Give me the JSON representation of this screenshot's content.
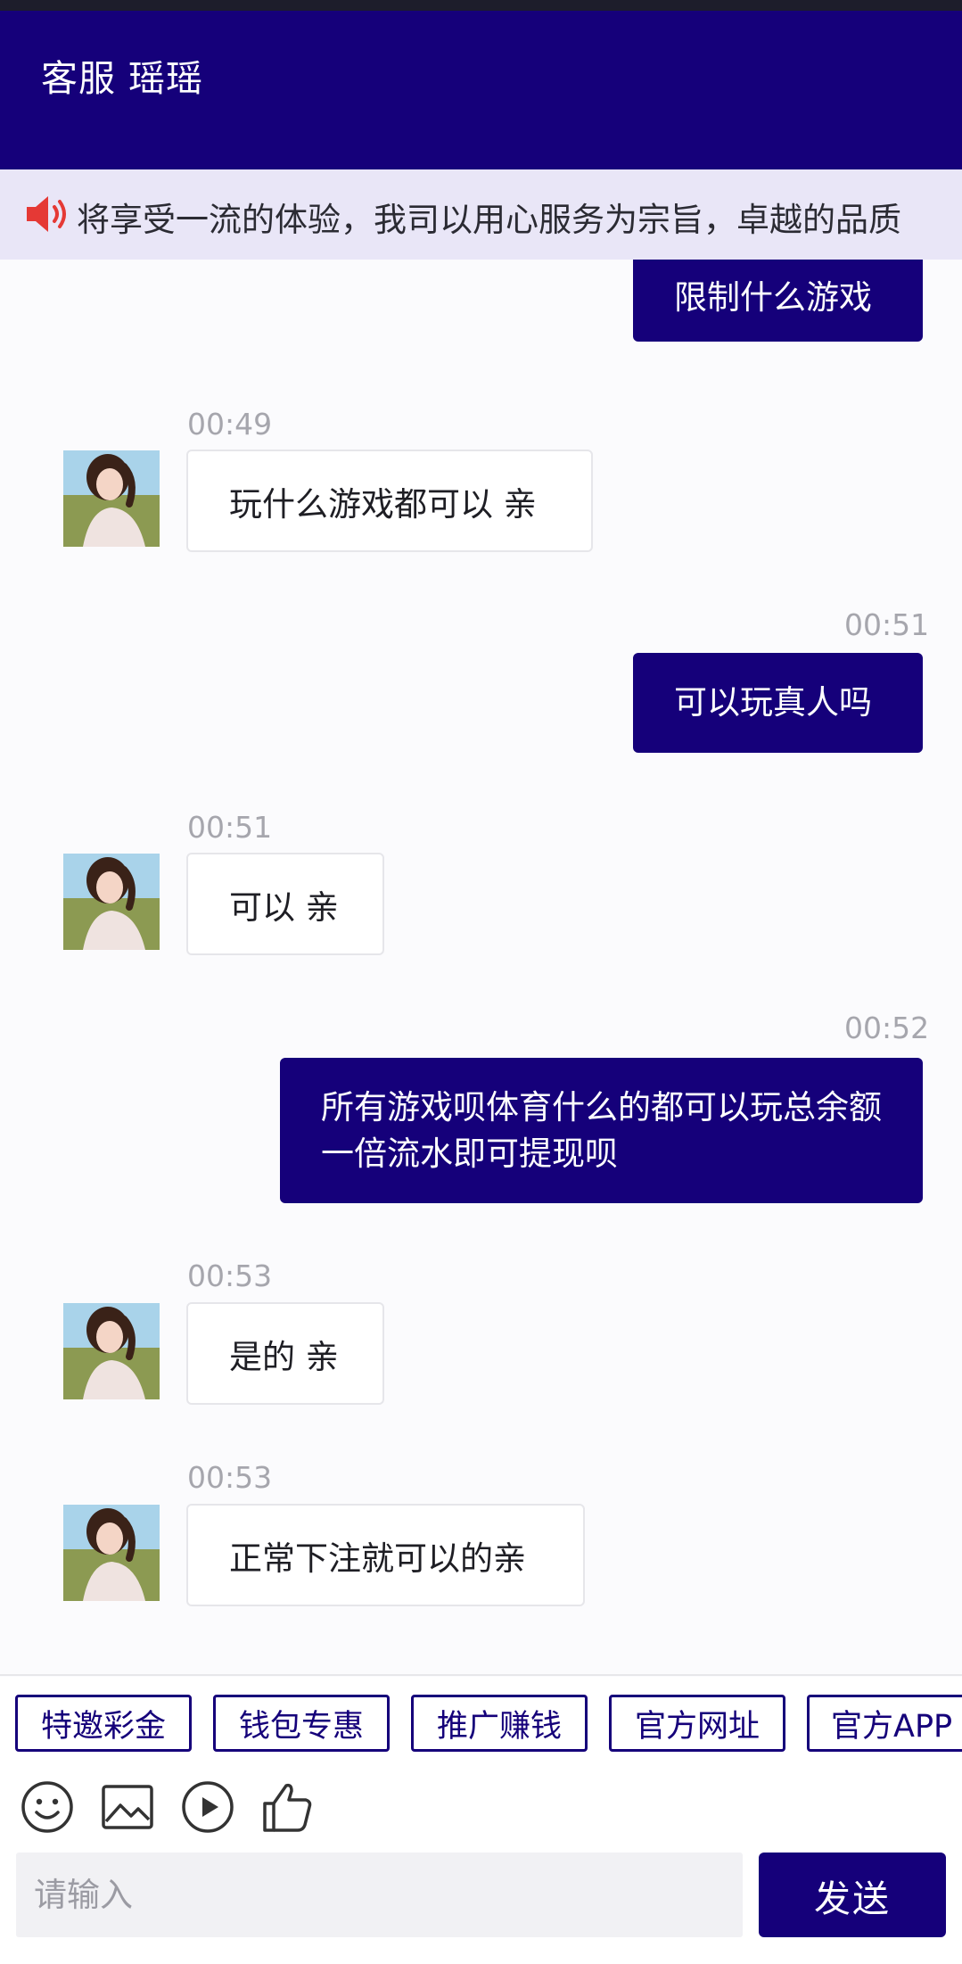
{
  "header": {
    "title": "客服 瑶瑶"
  },
  "notice": {
    "text": "将享受一流的体验，我司以用心服务为宗旨，卓越的品质"
  },
  "messages": [
    {
      "side": "out",
      "time": "",
      "text": "限制什么游戏"
    },
    {
      "side": "in",
      "time": "00:49",
      "text": "玩什么游戏都可以 亲"
    },
    {
      "side": "out",
      "time": "00:51",
      "text": "可以玩真人吗"
    },
    {
      "side": "in",
      "time": "00:51",
      "text": "可以 亲"
    },
    {
      "side": "out",
      "time": "00:52",
      "text": "所有游戏呗体育什么的都可以玩总余额一倍流水即可提现呗"
    },
    {
      "side": "in",
      "time": "00:53",
      "text": "是的 亲"
    },
    {
      "side": "in",
      "time": "00:53",
      "text": "正常下注就可以的亲"
    }
  ],
  "quick_replies": [
    "特邀彩金",
    "钱包专惠",
    "推广赚钱",
    "官方网址",
    "官方APP"
  ],
  "tools": [
    "emoji-icon",
    "image-icon",
    "video-icon",
    "thumbs-up-icon"
  ],
  "composer": {
    "placeholder": "请输入",
    "send_label": "发送"
  },
  "colors": {
    "brand": "#15007a",
    "notice_bg": "#e9e6f7",
    "speaker": "#e53935"
  }
}
